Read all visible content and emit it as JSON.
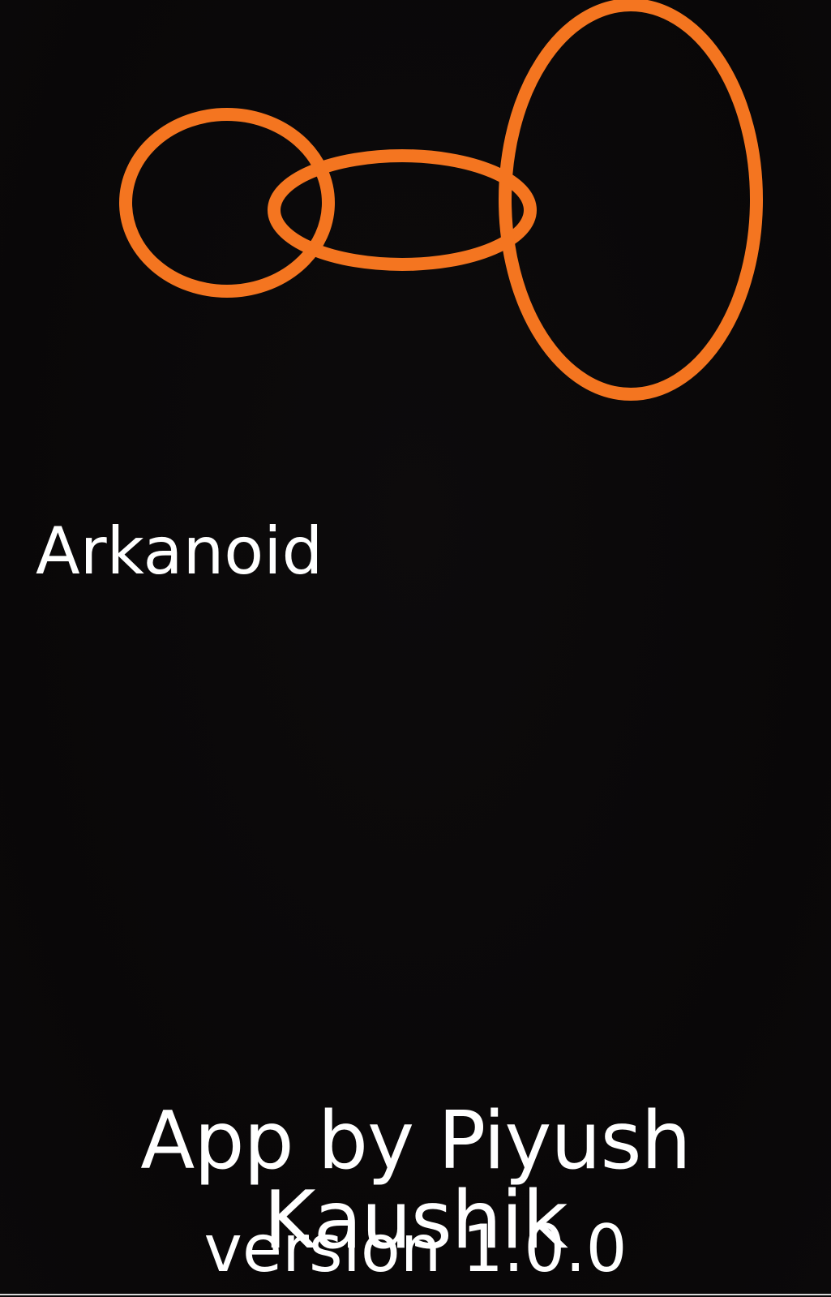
{
  "app": {
    "title": "Arkanoid",
    "credits": "App by Piyush Kaushik",
    "version": "version 1.0.0"
  },
  "logo": {
    "icon": "three-interlinked-rings-icon",
    "stroke_color": "#f47520"
  },
  "colors": {
    "background": "#0a0809",
    "text": "#ffffff",
    "accent": "#f47520"
  }
}
